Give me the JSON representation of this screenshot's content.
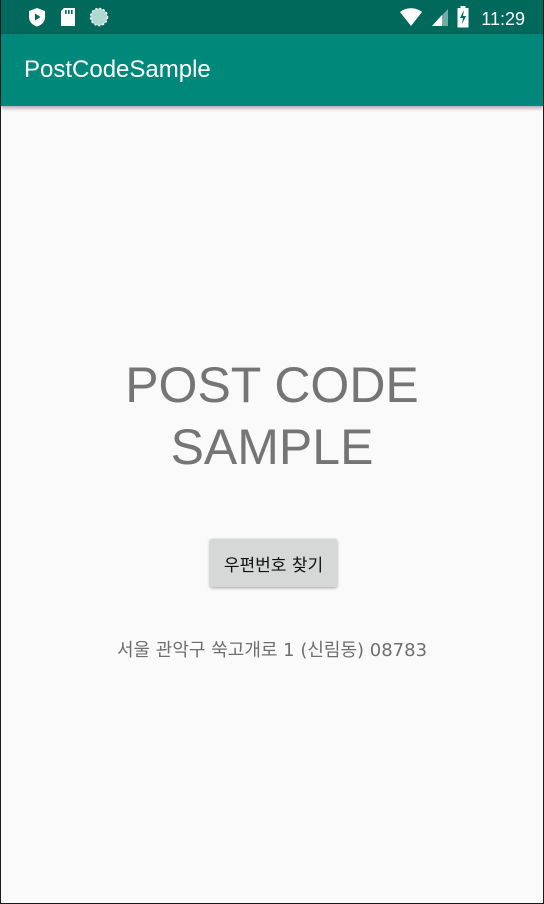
{
  "status_bar": {
    "time": "11:29",
    "icons_left": [
      "shield-play-icon",
      "sd-card-icon",
      "circle-icon"
    ],
    "icons_right": [
      "wifi-icon",
      "signal-icon",
      "battery-charging-icon"
    ],
    "background": "#00695c"
  },
  "app_bar": {
    "title": "PostCodeSample",
    "background": "#00897b"
  },
  "main": {
    "heading_line1": "POST CODE",
    "heading_line2": "SAMPLE",
    "find_button_label": "우편번호 찾기",
    "address": "서울 관악구 쑥고개로 1  (신림동) 08783"
  }
}
